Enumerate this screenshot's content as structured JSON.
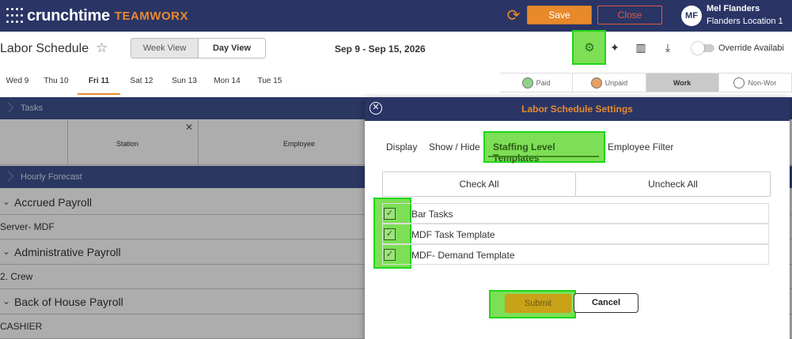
{
  "app": {
    "logo_main": "crunchtime",
    "logo_sub": "TEAMWORX",
    "save_label": "Save",
    "close_label": "Close",
    "user_initials": "MF",
    "user_name": "Mel Flanders",
    "user_location": "Flanders Location 1"
  },
  "header": {
    "title": "Labor Schedule",
    "week_view": "Week View",
    "day_view": "Day View",
    "date_range": "Sep 9 - Sep 15, 2026",
    "override_label": "Override Availabi"
  },
  "days": [
    "Wed 9",
    "Thu 10",
    "Fri 11",
    "Sat 12",
    "Sun 13",
    "Mon 14",
    "Tue 15"
  ],
  "legend": {
    "paid": "Paid",
    "unpaid": "Unpaid",
    "work": "Work",
    "nonwork": "Non-Wor"
  },
  "grid": {
    "tasks": "Tasks",
    "station": "Station",
    "employee": "Employee",
    "hourly_forecast": "Hourly Forecast",
    "groups": [
      "Accrued Payroll",
      "Administrative Payroll",
      "Back of House Payroll"
    ],
    "subs": [
      "Server- MDF",
      "2. Crew",
      "CASHIER"
    ]
  },
  "modal": {
    "title": "Labor Schedule Settings",
    "tabs": {
      "display": "Display",
      "show_hide": "Show / Hide",
      "staffing": "Staffing Level Templates",
      "employee_filter": "Employee Filter"
    },
    "check_all": "Check All",
    "uncheck_all": "Uncheck All",
    "templates": [
      "Bar Tasks",
      "MDF Task Template",
      "MDF- Demand Template"
    ],
    "submit": "Submit",
    "cancel": "Cancel"
  }
}
